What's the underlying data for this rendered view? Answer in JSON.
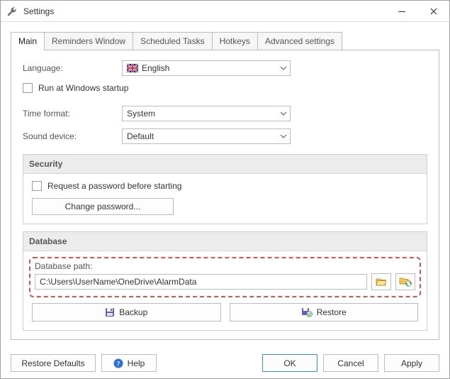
{
  "window": {
    "title": "Settings"
  },
  "tabs": [
    {
      "label": "Main"
    },
    {
      "label": "Reminders Window"
    },
    {
      "label": "Scheduled Tasks"
    },
    {
      "label": "Hotkeys"
    },
    {
      "label": "Advanced settings"
    }
  ],
  "main": {
    "language_label": "Language:",
    "language_value": "English",
    "run_at_startup_label": "Run at Windows startup",
    "run_at_startup_checked": false,
    "time_format_label": "Time format:",
    "time_format_value": "System",
    "sound_device_label": "Sound device:",
    "sound_device_value": "Default"
  },
  "security": {
    "title": "Security",
    "request_password_label": "Request a password before starting",
    "request_password_checked": false,
    "change_password_label": "Change password..."
  },
  "database": {
    "title": "Database",
    "path_label": "Database path:",
    "path_value": "C:\\Users\\UserName\\OneDrive\\AlarmData",
    "backup_label": "Backup",
    "restore_label": "Restore"
  },
  "footer": {
    "restore_defaults": "Restore Defaults",
    "help": "Help",
    "ok": "OK",
    "cancel": "Cancel",
    "apply": "Apply"
  }
}
